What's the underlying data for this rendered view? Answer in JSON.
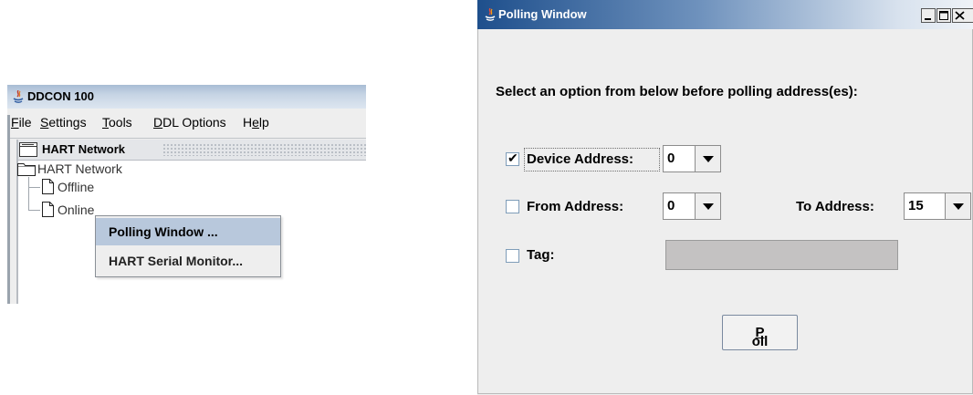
{
  "ddcon": {
    "title": "DDCON 100",
    "menu": [
      {
        "key": "F",
        "rest": "ile"
      },
      {
        "key": "S",
        "rest": "ettings"
      },
      {
        "key": "T",
        "rest": "ools"
      },
      {
        "key": "D",
        "rest": "DL Options"
      },
      {
        "pre": "H",
        "key": "e",
        "rest": "lp"
      }
    ],
    "internal_frame_title": "HART Network",
    "tree": {
      "root": "HART Network",
      "children": [
        "Offline",
        "Online"
      ]
    },
    "context_menu": [
      "Polling Window ...",
      "HART Serial Monitor..."
    ],
    "icons": {
      "app": "java-icon",
      "frame": "window-icon",
      "folder": "folder-icon",
      "document": "document-icon"
    }
  },
  "polling": {
    "title": "Polling Window",
    "instruction": "Select an option from below before polling address(es):",
    "device_address": {
      "label": "Device Address:",
      "checked": true,
      "value": "0"
    },
    "from_address": {
      "label": "From Address:",
      "checked": false,
      "value": "0"
    },
    "to_address": {
      "label": "To Address:",
      "value": "15"
    },
    "tag": {
      "label": "Tag:",
      "checked": false,
      "value": ""
    },
    "poll_button": {
      "key": "P",
      "rest": "oll"
    },
    "colors": {
      "title_start": "#1e4f8c",
      "title_end": "#eef2f7",
      "disabled_field": "#c4c2c2"
    }
  }
}
